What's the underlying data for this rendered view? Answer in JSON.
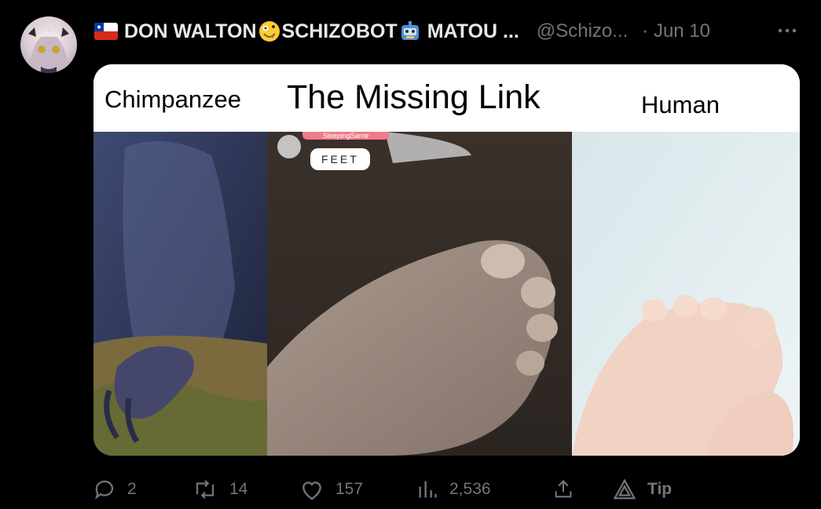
{
  "tweet": {
    "display_name": "DON WALTON",
    "name_part2": "SCHIZOBOT",
    "name_part3": "MATOU ...",
    "handle": "@Schizo...",
    "date": "· Jun 10",
    "more_icon": "more-horizontal-icon",
    "flag_icon": "chile-flag-icon",
    "emoji_1": "zany-face-emoji",
    "emoji_2": "robot-emoji"
  },
  "media": {
    "label_left": "Chimpanzee",
    "title": "The Missing Link",
    "label_right": "Human",
    "overlay_badge": "FEET",
    "overlay_pink": "SleepingSame"
  },
  "actions": {
    "replies": "2",
    "reposts": "14",
    "likes": "157",
    "views": "2,536",
    "tip": "Tip"
  },
  "colors": {
    "background": "#000000",
    "text": "#e7e9ea",
    "muted": "#71767b"
  }
}
